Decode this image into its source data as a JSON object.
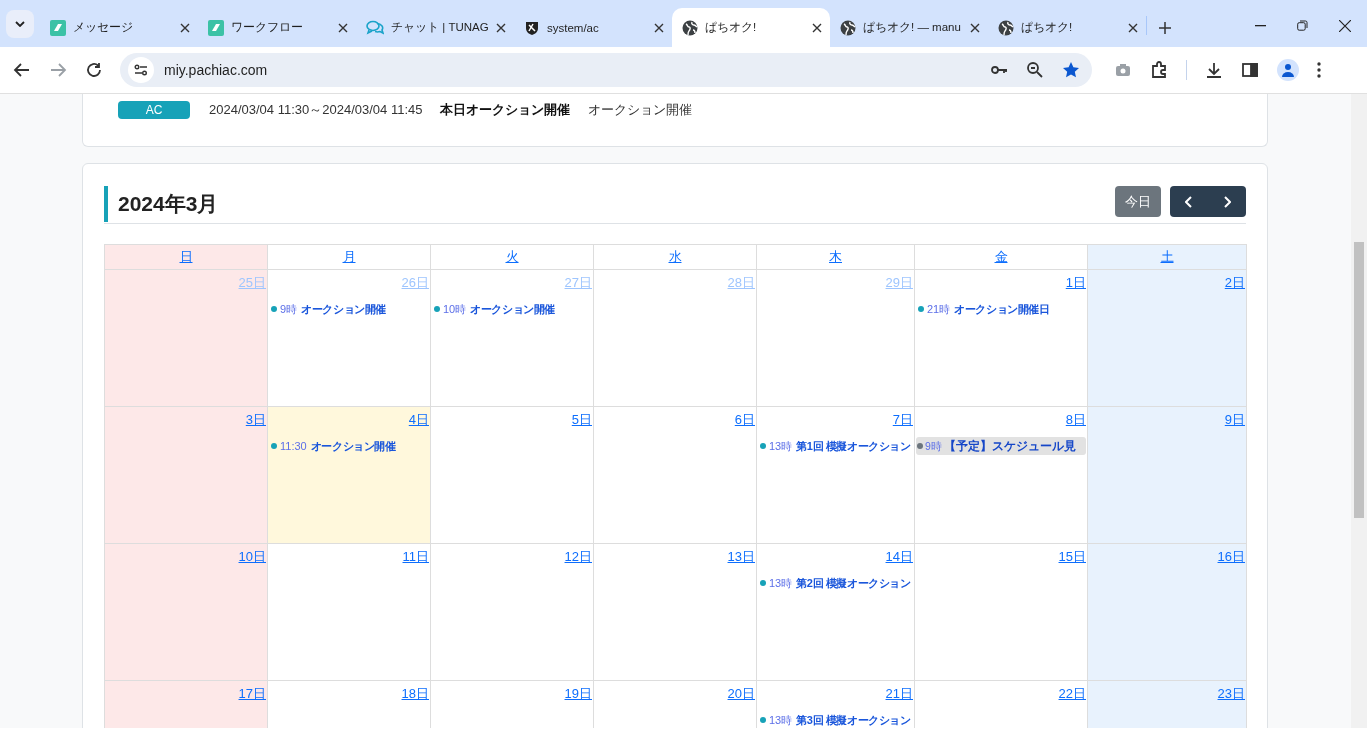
{
  "browser": {
    "tabs": [
      {
        "title": "メッセージ",
        "kind": "app",
        "selected": false
      },
      {
        "title": "ワークフロー",
        "kind": "app",
        "selected": false
      },
      {
        "title": "チャット | TUNAG",
        "kind": "chat",
        "selected": false
      },
      {
        "title": "system/ac",
        "kind": "shield",
        "selected": false
      },
      {
        "title": "ぱちオク!",
        "kind": "globe",
        "selected": true
      },
      {
        "title": "ぱちオク! — manu",
        "kind": "globe",
        "selected": false
      },
      {
        "title": "ぱちオク!",
        "kind": "globe",
        "selected": false
      }
    ],
    "address": "miy.pachiac.com"
  },
  "notice": {
    "badge": "AC",
    "period": "2024/03/04 11:30～2024/03/04 11:45",
    "title": "本日オークション開催",
    "text": "オークション開催"
  },
  "calendar": {
    "title": "2024年3月",
    "today_button": "今日",
    "columns": [
      {
        "label": "日",
        "kind": "sunday"
      },
      {
        "label": "月",
        "kind": "weekday"
      },
      {
        "label": "火",
        "kind": "weekday"
      },
      {
        "label": "水",
        "kind": "weekday"
      },
      {
        "label": "木",
        "kind": "weekday"
      },
      {
        "label": "金",
        "kind": "weekday"
      },
      {
        "label": "土",
        "kind": "saturday"
      }
    ],
    "weeks": [
      {
        "days": [
          {
            "label": "25日",
            "other_month": true,
            "today": false
          },
          {
            "label": "26日",
            "other_month": true,
            "today": false,
            "events": [
              {
                "time": "9時",
                "title": "オークション開催",
                "color": "#17a2b8",
                "kind": "normal"
              }
            ]
          },
          {
            "label": "27日",
            "other_month": true,
            "today": false,
            "events": [
              {
                "time": "10時",
                "title": "オークション開催",
                "color": "#17a2b8",
                "kind": "normal"
              }
            ]
          },
          {
            "label": "28日",
            "other_month": true,
            "today": false
          },
          {
            "label": "29日",
            "other_month": true,
            "today": false
          },
          {
            "label": "1日",
            "other_month": false,
            "today": false,
            "events": [
              {
                "time": "21時",
                "title": "オークション開催日",
                "color": "#17a2b8",
                "kind": "normal"
              }
            ]
          },
          {
            "label": "2日",
            "other_month": false,
            "today": false
          }
        ]
      },
      {
        "days": [
          {
            "label": "3日",
            "other_month": false,
            "today": false
          },
          {
            "label": "4日",
            "other_month": false,
            "today": true,
            "events": [
              {
                "time": "11:30",
                "title": "オークション開催",
                "color": "#17a2b8",
                "kind": "normal"
              }
            ]
          },
          {
            "label": "5日",
            "other_month": false,
            "today": false
          },
          {
            "label": "6日",
            "other_month": false,
            "today": false
          },
          {
            "label": "7日",
            "other_month": false,
            "today": false,
            "events": [
              {
                "time": "13時",
                "title": "第1回 模擬オークション",
                "color": "#17a2b8",
                "kind": "normal"
              }
            ]
          },
          {
            "label": "8日",
            "other_month": false,
            "today": false,
            "events": [
              {
                "time": "9時",
                "title": "【予定】スケジュール見",
                "color": "#6c757d",
                "kind": "tentative"
              }
            ]
          },
          {
            "label": "9日",
            "other_month": false,
            "today": false
          }
        ]
      },
      {
        "days": [
          {
            "label": "10日",
            "other_month": false,
            "today": false
          },
          {
            "label": "11日",
            "other_month": false,
            "today": false
          },
          {
            "label": "12日",
            "other_month": false,
            "today": false
          },
          {
            "label": "13日",
            "other_month": false,
            "today": false
          },
          {
            "label": "14日",
            "other_month": false,
            "today": false,
            "events": [
              {
                "time": "13時",
                "title": "第2回 模擬オークション",
                "color": "#17a2b8",
                "kind": "normal"
              }
            ]
          },
          {
            "label": "15日",
            "other_month": false,
            "today": false
          },
          {
            "label": "16日",
            "other_month": false,
            "today": false
          }
        ]
      },
      {
        "days": [
          {
            "label": "17日",
            "other_month": false,
            "today": false
          },
          {
            "label": "18日",
            "other_month": false,
            "today": false
          },
          {
            "label": "19日",
            "other_month": false,
            "today": false
          },
          {
            "label": "20日",
            "other_month": false,
            "today": false
          },
          {
            "label": "21日",
            "other_month": false,
            "today": false,
            "events": [
              {
                "time": "13時",
                "title": "第3回 模擬オークション",
                "color": "#17a2b8",
                "kind": "normal"
              }
            ]
          },
          {
            "label": "22日",
            "other_month": false,
            "today": false
          },
          {
            "label": "23日",
            "other_month": false,
            "today": false
          }
        ]
      }
    ]
  }
}
